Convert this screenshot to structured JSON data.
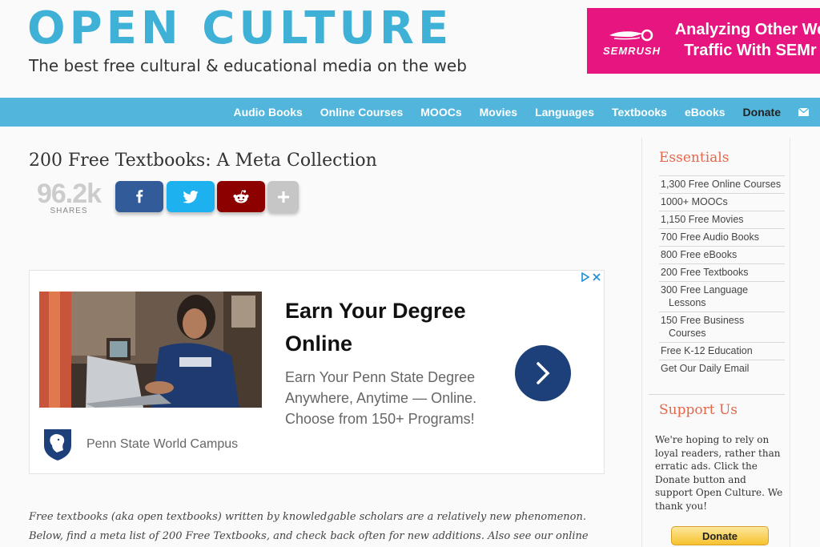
{
  "header": {
    "logo": "OPEN CULTURE",
    "tagline": "The best free cultural & educational media on the web"
  },
  "top_ad": {
    "brand": "SEMRUSH",
    "headline_line1": "Analyzing Other We",
    "headline_line2": "Traffic With SEMr"
  },
  "nav": {
    "items": [
      {
        "label": "Audio Books"
      },
      {
        "label": "Online Courses"
      },
      {
        "label": "MOOCs"
      },
      {
        "label": "Movies"
      },
      {
        "label": "Languages"
      },
      {
        "label": "Textbooks"
      },
      {
        "label": "eBooks"
      },
      {
        "label": "Donate"
      }
    ],
    "mail_icon": "mail-icon"
  },
  "article": {
    "title": "200 Free Textbooks: A Meta Collection",
    "share_count": "96.2k",
    "share_label": "SHARES",
    "share_buttons": [
      "facebook-icon",
      "twitter-icon",
      "reddit-icon",
      "plus-icon"
    ],
    "intro_line1": "Free textbooks (aka open textbooks) written by knowledgable scholars are a relatively new phenomenon.",
    "intro_line2": "Below, find a meta list of 200 Free Textbooks, and check back often for new additions. Also see our online"
  },
  "ad": {
    "headline": "Earn Your Degree Online",
    "body": "Earn Your Penn State Degree Anywhere, Anytime — Online. Choose from 150+ Programs!",
    "sponsor": "Penn State World Campus"
  },
  "sidebar": {
    "essentials_title": "Essentials",
    "essentials": [
      {
        "line1": "1,300 Free Online Courses",
        "line2": ""
      },
      {
        "line1": "1000+ MOOCs",
        "line2": ""
      },
      {
        "line1": "1,150 Free Movies",
        "line2": ""
      },
      {
        "line1": "700 Free Audio Books",
        "line2": ""
      },
      {
        "line1": "800 Free eBooks",
        "line2": ""
      },
      {
        "line1": "200 Free Textbooks",
        "line2": ""
      },
      {
        "line1": "300 Free Language",
        "line2": "Lessons"
      },
      {
        "line1": "150 Free Business",
        "line2": "Courses"
      },
      {
        "line1": "Free K-12 Education",
        "line2": ""
      },
      {
        "line1": "Get Our Daily Email",
        "line2": ""
      }
    ],
    "support_title": "Support Us",
    "support_text": "We're hoping to rely on loyal readers, rather than erratic ads. Click the Donate button and support Open Culture. We thank you!",
    "donate_label": "Donate"
  },
  "colors": {
    "brand": "#3fb0d6",
    "nav_bg": "#52b6dc",
    "accent": "#e4674a",
    "ad_pink": "#e6157f"
  }
}
